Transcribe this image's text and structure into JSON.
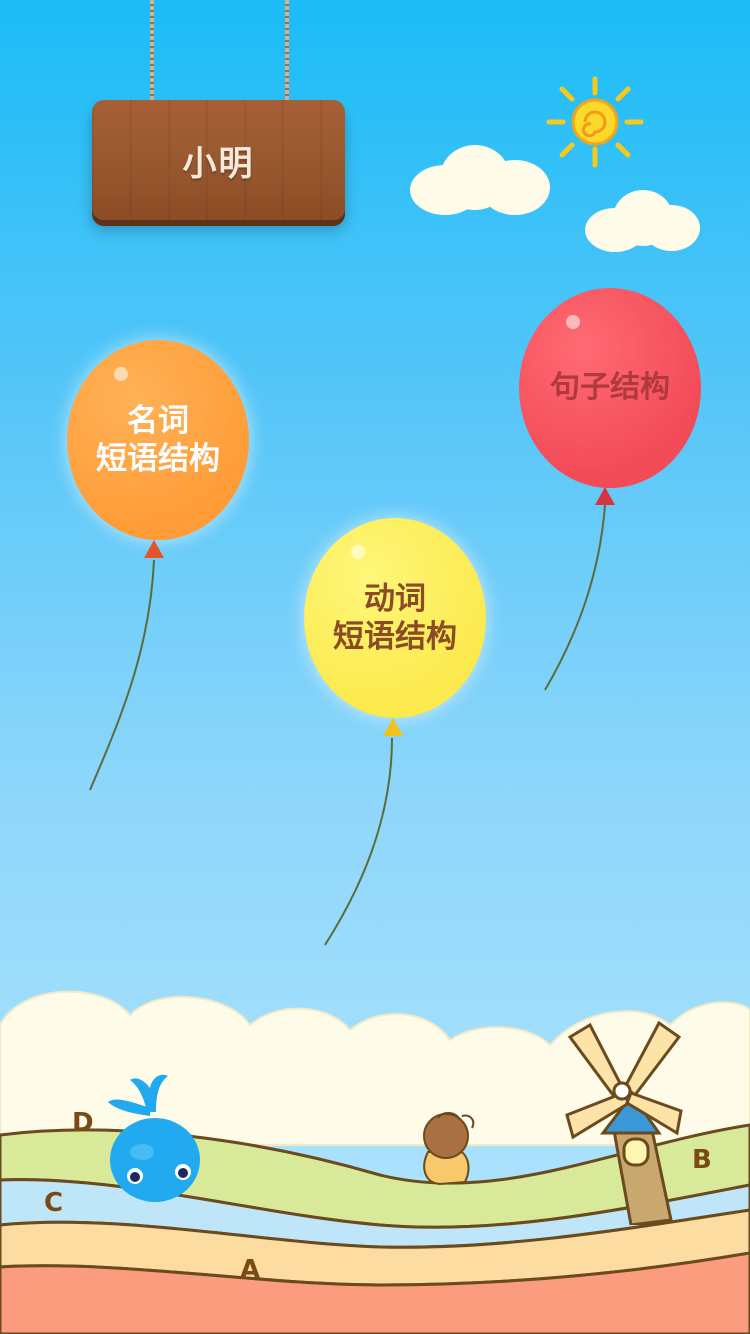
{
  "sign": {
    "name": "小明"
  },
  "balloons": [
    {
      "id": "noun",
      "lines": [
        "名词",
        "短语结构"
      ],
      "color": "#ff9c38"
    },
    {
      "id": "verb",
      "lines": [
        "动词",
        "短语结构"
      ],
      "color": "#fbe94e"
    },
    {
      "id": "sentence",
      "lines": [
        "句子结构"
      ],
      "color": "#f24b57"
    }
  ],
  "ground_letters": [
    "D",
    "C",
    "A",
    "B"
  ],
  "icons": {
    "sun": "sun-icon",
    "whale": "whale-mascot-icon",
    "windmill": "windmill-icon",
    "child": "child-figure-icon"
  }
}
